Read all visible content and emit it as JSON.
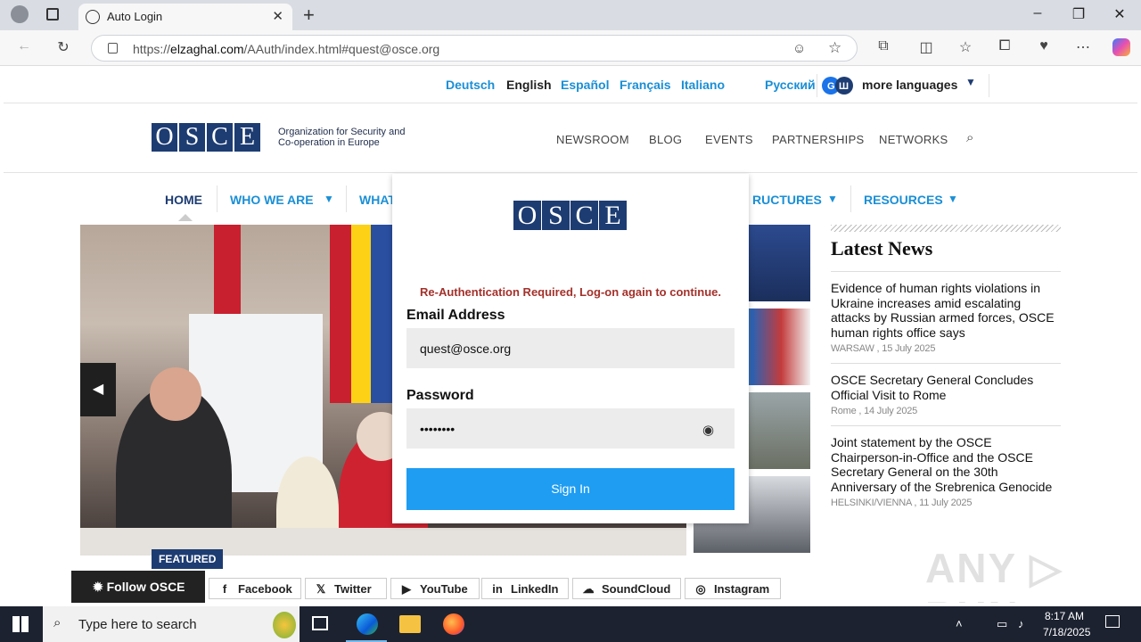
{
  "browser": {
    "tab_title": "Auto Login",
    "url_prefix": "https://",
    "url_domain": "elzaghal.com",
    "url_path": "/AAuth/index.html#quest@osce.org"
  },
  "languages": [
    "Deutsch",
    "English",
    "Español",
    "Français",
    "Italiano",
    "Русский"
  ],
  "active_language": "English",
  "more_languages": "more languages",
  "logo": {
    "letters": [
      "O",
      "S",
      "C",
      "E"
    ],
    "org_name": "Organization for Security and Co-operation in Europe"
  },
  "top_nav": [
    "NEWSROOM",
    "BLOG",
    "EVENTS",
    "PARTNERSHIPS",
    "NETWORKS"
  ],
  "main_nav": {
    "home": "HOME",
    "who": "WHO WE ARE",
    "what": "WHAT",
    "structures": "RUCTURES",
    "resources": "RESOURCES"
  },
  "hero": {
    "featured": "FEATURED"
  },
  "latest_news": {
    "title": "Latest News",
    "items": [
      {
        "title": "Evidence of human rights violations in Ukraine increases amid escalating attacks by Russian armed forces, OSCE human rights office says",
        "meta": "WARSAW , 15 July 2025"
      },
      {
        "title": "OSCE Secretary General Concludes Official Visit to Rome",
        "meta": "Rome , 14 July 2025"
      },
      {
        "title": "Joint statement by the OSCE Chairperson-in-Office and the OSCE Secretary General on the 30th Anniversary of the Srebrenica Genocide",
        "meta": "HELSINKI/VIENNA , 11 July 2025"
      }
    ]
  },
  "social": {
    "follow": "Follow OSCE",
    "links": [
      "Facebook",
      "Twitter",
      "YouTube",
      "LinkedIn",
      "SoundCloud",
      "Instagram"
    ]
  },
  "login": {
    "error": "Re-Authentication Required, Log-on again to continue.",
    "email_label": "Email Address",
    "email_value": "quest@osce.org",
    "password_label": "Password",
    "password_value": "••••••••",
    "sign_in": "Sign In"
  },
  "taskbar": {
    "search_placeholder": "Type here to search",
    "time": "8:17 AM",
    "date": "7/18/2025"
  },
  "colors": {
    "osce_navy": "#1d3c72",
    "link_blue": "#1a8fd6",
    "button_blue": "#1e9df2",
    "error_red": "#a3312b"
  }
}
